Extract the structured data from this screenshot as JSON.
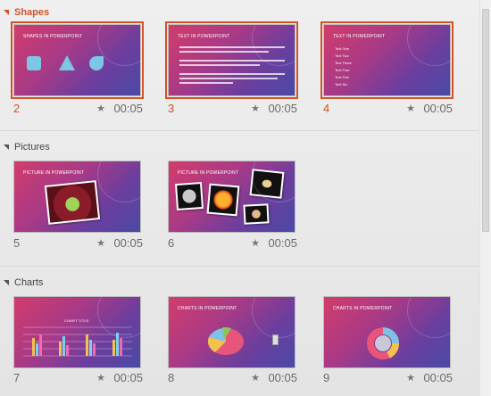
{
  "sections": [
    {
      "title": "Shapes",
      "active": true
    },
    {
      "title": "Pictures",
      "active": false
    },
    {
      "title": "Charts",
      "active": false
    }
  ],
  "slides": [
    {
      "number": "2",
      "duration": "00:05",
      "title": "SHAPES IN POWERPOINT",
      "selected": true
    },
    {
      "number": "3",
      "duration": "00:05",
      "title": "TEXT IN POWERPOINT",
      "selected": true
    },
    {
      "number": "4",
      "duration": "00:05",
      "title": "TEXT IN POWERPOINT",
      "selected": true,
      "list": [
        "Text One",
        "Text Two",
        "Text Three",
        "Text Four",
        "Text Five",
        "Text Six"
      ]
    },
    {
      "number": "5",
      "duration": "00:05",
      "title": "PICTURE IN POWERPOINT",
      "selected": false
    },
    {
      "number": "6",
      "duration": "00:05",
      "title": "PICTURE IN POWERPOINT",
      "selected": false
    },
    {
      "number": "7",
      "duration": "00:05",
      "title": "CHART TITLE",
      "selected": false
    },
    {
      "number": "8",
      "duration": "00:05",
      "title": "CHARTS IN POWERPOINT",
      "selected": false
    },
    {
      "number": "9",
      "duration": "00:05",
      "title": "CHARTS IN POWERPOINT",
      "selected": false
    }
  ],
  "icons": {
    "section_caret": "caret-down-icon",
    "timing": "star-icon"
  },
  "colors": {
    "accent": "#d0522b",
    "slide_bg_start": "#d23c6c",
    "slide_bg_end": "#4a4aa6"
  }
}
